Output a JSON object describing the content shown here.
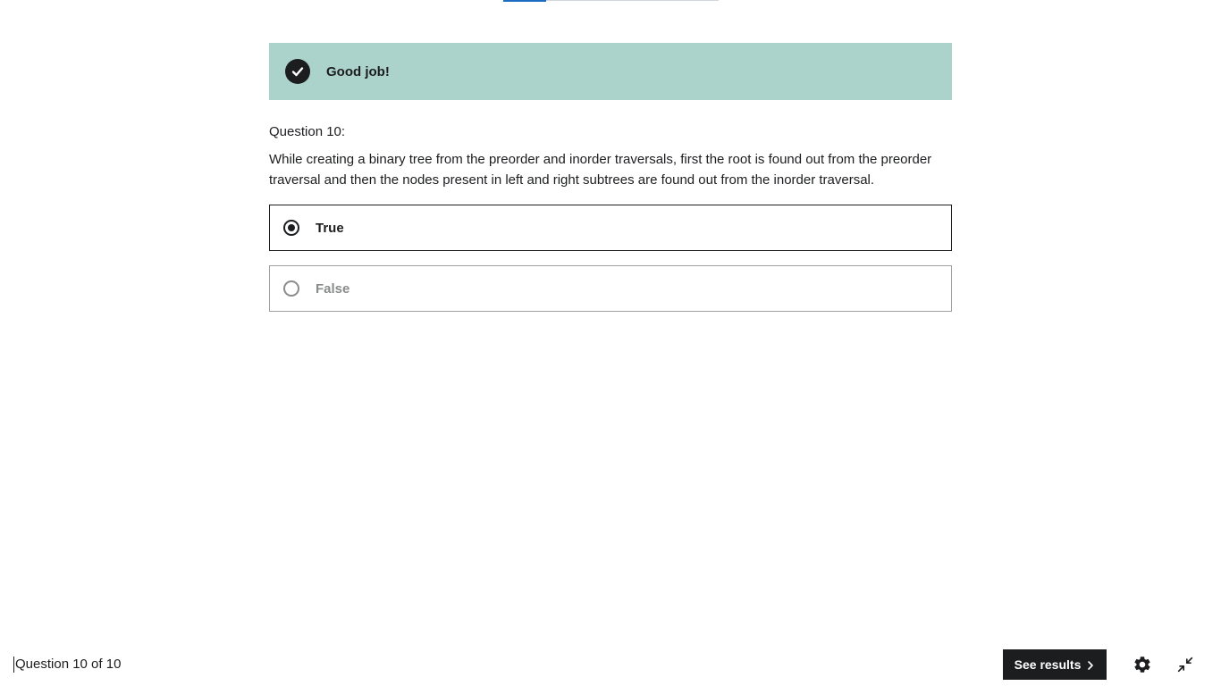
{
  "progress": {
    "fraction_complete": 0.2
  },
  "feedback": {
    "message": "Good job!",
    "icon": "check-circle-icon",
    "background_color": "#acd2cc"
  },
  "question": {
    "number_label": "Question 10:",
    "text": "While creating a binary tree from the preorder and inorder traversals, first the root is found out from the preorder traversal and then the nodes present in left and right subtrees are found out from the inorder traversal."
  },
  "answers": [
    {
      "label": "True",
      "selected": true
    },
    {
      "label": "False",
      "selected": false
    }
  ],
  "footer": {
    "counter": "Question 10 of 10",
    "see_results_label": "See results",
    "settings_icon": "gear-icon",
    "collapse_icon": "collapse-icon"
  }
}
